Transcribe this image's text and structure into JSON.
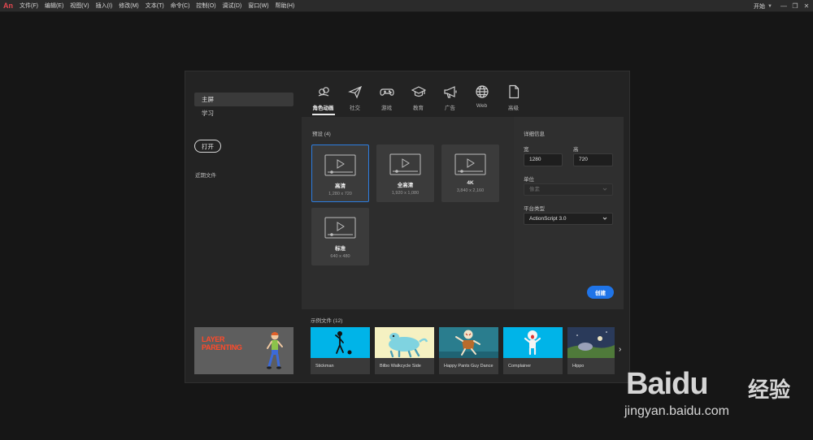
{
  "app": {
    "logo": "An"
  },
  "menubar": {
    "items": [
      "文件(F)",
      "编辑(E)",
      "视图(V)",
      "插入(I)",
      "修改(M)",
      "文本(T)",
      "命令(C)",
      "控制(O)",
      "调试(D)",
      "窗口(W)",
      "帮助(H)"
    ],
    "workspace": "开始",
    "window_buttons": [
      "—",
      "❐",
      "✕"
    ]
  },
  "left_nav": {
    "items": [
      {
        "label": "主屏",
        "active": true
      },
      {
        "label": "学习",
        "active": false
      }
    ],
    "open_label": "打开",
    "recent_label": "近期文件",
    "promo_text_1": "LAYER",
    "promo_text_2": "PARENTING"
  },
  "tabs": [
    {
      "label": "角色动画",
      "icon": "character-animation-icon",
      "active": true
    },
    {
      "label": "社交",
      "icon": "send-icon",
      "active": false
    },
    {
      "label": "游戏",
      "icon": "gamepad-icon",
      "active": false
    },
    {
      "label": "教育",
      "icon": "graduation-cap-icon",
      "active": false
    },
    {
      "label": "广告",
      "icon": "megaphone-icon",
      "active": false
    },
    {
      "label": "Web",
      "icon": "globe-icon",
      "active": false
    },
    {
      "label": "高级",
      "icon": "document-icon",
      "active": false
    }
  ],
  "presets": {
    "label": "预设 (4)",
    "items": [
      {
        "name": "高清",
        "size": "1,280 x 720",
        "selected": true
      },
      {
        "name": "全高清",
        "size": "1,920 x 1,080",
        "selected": false
      },
      {
        "name": "4K",
        "size": "3,840 x 2,160",
        "selected": false
      },
      {
        "name": "标准",
        "size": "640 x 480",
        "selected": false
      }
    ]
  },
  "details": {
    "title": "详细信息",
    "width_label": "宽",
    "width_value": "1280",
    "height_label": "高",
    "height_value": "720",
    "unit_label": "单位",
    "unit_value": "像素",
    "platform_label": "平台类型",
    "platform_value": "ActionScript 3.0",
    "create_label": "创建"
  },
  "samples": {
    "label": "示例文件 (12)",
    "items": [
      {
        "name": "Stickman"
      },
      {
        "name": "Bilbo Walkcycle Side"
      },
      {
        "name": "Happy Pants Guy Dance"
      },
      {
        "name": "Complainer"
      },
      {
        "name": "Hippo"
      }
    ],
    "next_arrow": "›"
  },
  "watermark": {
    "brand": "Bai",
    "brand_paw": "du",
    "brand_cn": "经验",
    "url": "jingyan.baidu.com"
  },
  "colors": {
    "accent": "#1f74e8",
    "selected_border": "#2d7de0",
    "promo_text": "#ff4a2a",
    "sample_sky": "#00b4e8"
  }
}
